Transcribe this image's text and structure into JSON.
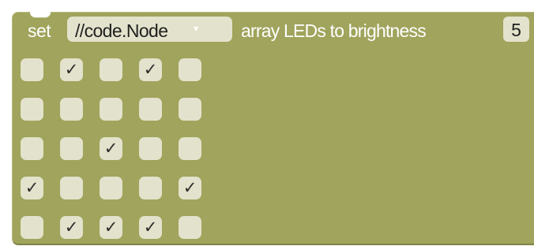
{
  "block": {
    "set_label": "set",
    "dropdown": {
      "value": "//code.Node",
      "arrow": "▾"
    },
    "array_label": "array LEDs to brightness",
    "brightness": "5"
  },
  "led_grid": [
    [
      false,
      true,
      false,
      true,
      false
    ],
    [
      false,
      false,
      false,
      false,
      false
    ],
    [
      false,
      false,
      true,
      false,
      false
    ],
    [
      true,
      false,
      false,
      false,
      true
    ],
    [
      false,
      true,
      true,
      true,
      false
    ]
  ],
  "check_glyph": "✓",
  "colors": {
    "block": "#a0a45c",
    "field": "#e3e2cc",
    "label_text": "#ffffff"
  }
}
